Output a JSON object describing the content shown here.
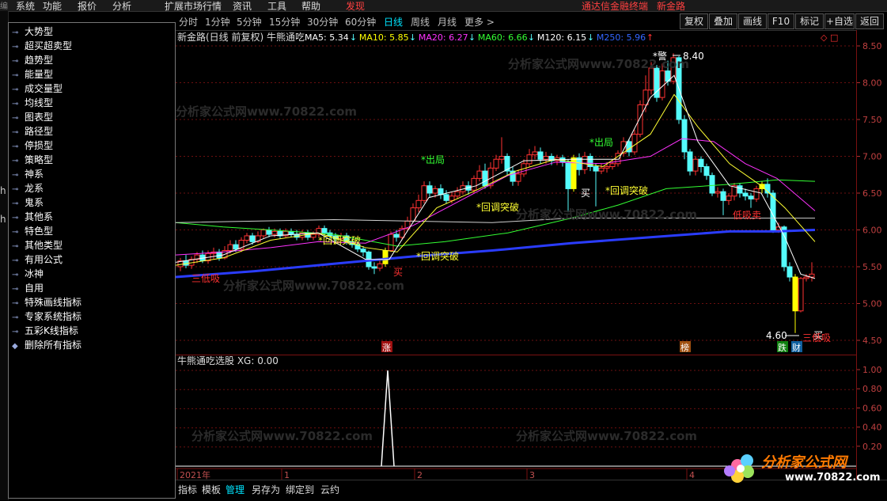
{
  "menubar": {
    "items": [
      "系统",
      "功能",
      "报价",
      "分析",
      "扩展市场行情",
      "资讯",
      "工具",
      "帮助"
    ],
    "highlight": "发现",
    "right_items": [
      "通达信金融终端",
      "新金路"
    ]
  },
  "indicator_menu": {
    "items": [
      "大势型",
      "超买超卖型",
      "趋势型",
      "能量型",
      "成交量型",
      "均线型",
      "图表型",
      "路径型",
      "停损型",
      "策略型",
      "神系",
      "龙系",
      "鬼系",
      "其他系",
      "特色型",
      "其他类型",
      "有用公式",
      "冰神",
      "自用",
      "特殊画线指标",
      "专家系统指标",
      "五彩K线指标",
      "删除所有指标"
    ]
  },
  "period_tabs": [
    "分时",
    "1分钟",
    "5分钟",
    "15分钟",
    "30分钟",
    "60分钟",
    "日线",
    "周线",
    "月线",
    "更多 >"
  ],
  "active_period": "日线",
  "toolbar_right": [
    "复权",
    "叠加",
    "画线",
    "F10",
    "标记",
    "+自选",
    "返回"
  ],
  "main_legend": {
    "title": "新金路(日线 前复权) 牛熊通吃",
    "ma": [
      {
        "label": "MA5: 5.34",
        "arrow": "↓",
        "color": "#ffffff"
      },
      {
        "label": "MA10: 5.85",
        "arrow": "↓",
        "color": "#ffff00"
      },
      {
        "label": "MA20: 6.27",
        "arrow": "↓",
        "color": "#ff33ff"
      },
      {
        "label": "MA60: 6.66",
        "arrow": "↓",
        "color": "#33ff33"
      },
      {
        "label": "M120: 6.15",
        "arrow": "↓",
        "color": "#ffffff"
      },
      {
        "label": "M250: 5.96",
        "arrow": "↑",
        "color": "#3366ff"
      }
    ]
  },
  "price_axis": [
    "8.50",
    "8.00",
    "7.50",
    "7.00",
    "6.50",
    "6.00",
    "5.50",
    "5.00",
    "4.50"
  ],
  "sub_axis": [
    "1.00",
    "0.80",
    "0.60",
    "0.40",
    "0.20"
  ],
  "sub_legend": "牛熊通吃选股 XG: 0.00",
  "time_axis": [
    "2021年",
    "1",
    "2",
    "3",
    "4"
  ],
  "annotations": {
    "high": "8.40",
    "low": "4.60",
    "warn": "*警",
    "exit1": "*出局",
    "exit2": "*出局",
    "breakout1": "*回调突破",
    "breakout2": "*回调突破",
    "breakout3": "*回调突破",
    "breakout4": "*回调突破",
    "buy1": "买",
    "buy2": "买",
    "buy3": "买",
    "dip1": "三低吸",
    "dip2": "三低吸",
    "lowsell": "低吸卖",
    "tag_zhang": "涨",
    "tag_bang": "榜",
    "tag_die": "跌",
    "tag_cai": "财"
  },
  "bottom_tabs": [
    "指标",
    "模板",
    "管理",
    "另存为",
    "绑定到",
    "云约"
  ],
  "active_bottom_tab": "管理",
  "logo": {
    "title": "分析家公式网",
    "url": "www.70822.com"
  },
  "watermark": "分析家公式网www.70822.com",
  "colors": {
    "up": "#ff3232",
    "down": "#54fcfc",
    "grid": "#6b0f0f",
    "buy_bar": "#ffff00"
  }
}
